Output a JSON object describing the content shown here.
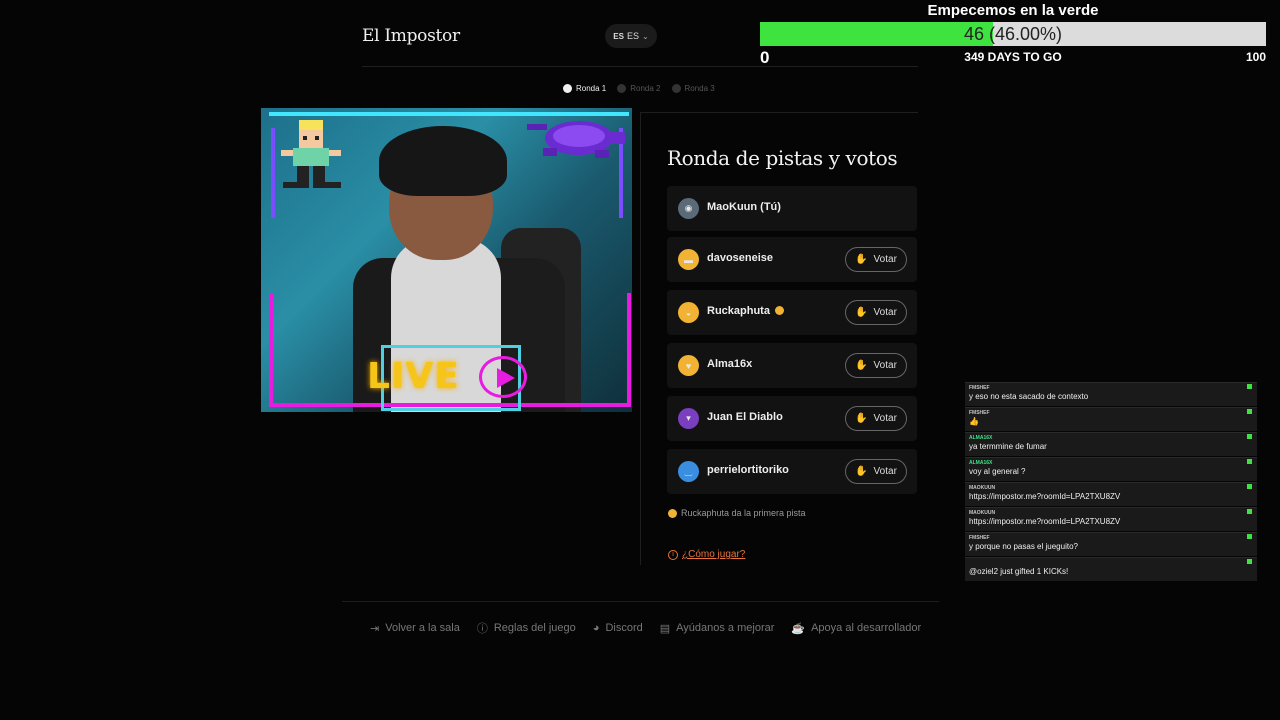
{
  "app": {
    "brand": "El Impostor"
  },
  "language": {
    "flag": "ES",
    "label": "ES"
  },
  "goal": {
    "title": "Empecemos en la verde",
    "current": 46,
    "percent_text": "(46.00%)",
    "progress": 0.46,
    "min": "0",
    "max": "100",
    "days_to_go": "349 DAYS TO GO"
  },
  "rounds": [
    {
      "label": "Ronda 1",
      "active": true
    },
    {
      "label": "Ronda 2",
      "active": false
    },
    {
      "label": "Ronda 3",
      "active": false
    }
  ],
  "stream_overlay": {
    "live_text": "LIVE"
  },
  "panel": {
    "title": "Ronda de pistas y votos"
  },
  "players": [
    {
      "name": "MaoKuun (Tú)",
      "avatar_color": "#5b6a78",
      "can_vote": false,
      "vote_label": ""
    },
    {
      "name": "davoseneise",
      "avatar_color": "#f2b233",
      "can_vote": true,
      "vote_label": "Votar"
    },
    {
      "name": "Ruckaphuta",
      "avatar_color": "#f2b233",
      "can_vote": true,
      "vote_label": "Votar"
    },
    {
      "name": "Alma16x",
      "avatar_color": "#f2b233",
      "can_vote": true,
      "vote_label": "Votar"
    },
    {
      "name": "Juan El Diablo",
      "avatar_color": "#7a3fbf",
      "can_vote": true,
      "vote_label": "Votar"
    },
    {
      "name": "perrielortitoriko",
      "avatar_color": "#3a8ee0",
      "can_vote": true,
      "vote_label": "Votar"
    }
  ],
  "clue_note": "Ruckaphuta da la primera pista",
  "howto": "¿Cómo jugar?",
  "footer": [
    {
      "label": "Volver a la sala",
      "icon": "logout-icon"
    },
    {
      "label": "Reglas del juego",
      "icon": "info-icon"
    },
    {
      "label": "Discord",
      "icon": "discord-icon"
    },
    {
      "label": "Ayúdanos a mejorar",
      "icon": "feedback-icon"
    },
    {
      "label": "Apoya al desarrollador",
      "icon": "coffee-icon"
    }
  ],
  "chat": [
    {
      "user": "FMSHEF",
      "text": "y eso no esta sacado de contexto"
    },
    {
      "user": "FMSHEF",
      "text": "👍"
    },
    {
      "user": "ALMA16X",
      "text": "ya termmine de fumar"
    },
    {
      "user": "ALMA16X",
      "text": "voy al general ?"
    },
    {
      "user": "MAOKUUN",
      "text": "https://impostor.me?roomId=LPA2TXU8ZV"
    },
    {
      "user": "MAOKUUN",
      "text": "https://impostor.me?roomId=LPA2TXU8ZV"
    },
    {
      "user": "FMSHEF",
      "text": "y porque no pasas el jueguito?"
    },
    {
      "user": "",
      "text": "@oziel2 just gifted 1 KICKs!"
    }
  ]
}
